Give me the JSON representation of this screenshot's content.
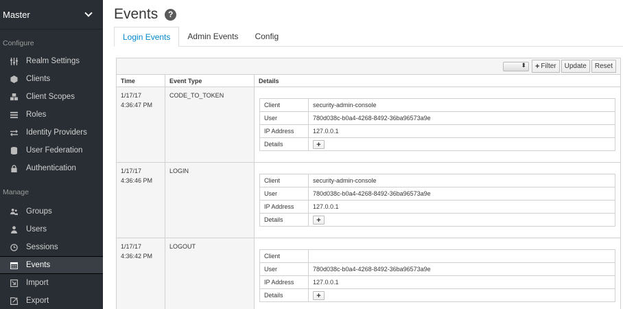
{
  "sidebar": {
    "realm": "Master",
    "configure_label": "Configure",
    "manage_label": "Manage",
    "configure_items": [
      {
        "label": "Realm Settings",
        "icon": "sliders-icon"
      },
      {
        "label": "Clients",
        "icon": "cube-icon"
      },
      {
        "label": "Client Scopes",
        "icon": "cubes-icon"
      },
      {
        "label": "Roles",
        "icon": "list-icon"
      },
      {
        "label": "Identity Providers",
        "icon": "exchange-icon"
      },
      {
        "label": "User Federation",
        "icon": "database-icon"
      },
      {
        "label": "Authentication",
        "icon": "lock-icon"
      }
    ],
    "manage_items": [
      {
        "label": "Groups",
        "icon": "users-icon"
      },
      {
        "label": "Users",
        "icon": "user-icon"
      },
      {
        "label": "Sessions",
        "icon": "clock-icon"
      },
      {
        "label": "Events",
        "icon": "calendar-icon",
        "active": true
      },
      {
        "label": "Import",
        "icon": "import-icon"
      },
      {
        "label": "Export",
        "icon": "export-icon"
      }
    ]
  },
  "page": {
    "title": "Events",
    "tabs": [
      {
        "label": "Login Events",
        "active": true
      },
      {
        "label": "Admin Events"
      },
      {
        "label": "Config"
      }
    ]
  },
  "toolbar": {
    "filter_label": "Filter",
    "update_label": "Update",
    "reset_label": "Reset"
  },
  "table": {
    "headers": {
      "time": "Time",
      "event_type": "Event Type",
      "details": "Details"
    },
    "detail_keys": {
      "client": "Client",
      "user": "User",
      "ip": "IP Address",
      "details": "Details"
    },
    "rows": [
      {
        "date": "1/17/17",
        "time": "4:36:47 PM",
        "type": "CODE_TO_TOKEN",
        "client": "security-admin-console",
        "user": "780d038c-b0a4-4268-8492-36ba96573a9e",
        "ip": "127.0.0.1"
      },
      {
        "date": "1/17/17",
        "time": "4:36:46 PM",
        "type": "LOGIN",
        "client": "security-admin-console",
        "user": "780d038c-b0a4-4268-8492-36ba96573a9e",
        "ip": "127.0.0.1"
      },
      {
        "date": "1/17/17",
        "time": "4:36:42 PM",
        "type": "LOGOUT",
        "client": "",
        "user": "780d038c-b0a4-4268-8492-36ba96573a9e",
        "ip": "127.0.0.1"
      }
    ]
  },
  "colors": {
    "sidebar_bg": "#292e34",
    "accent": "#0088ce",
    "active_item_bg": "#393f44"
  }
}
